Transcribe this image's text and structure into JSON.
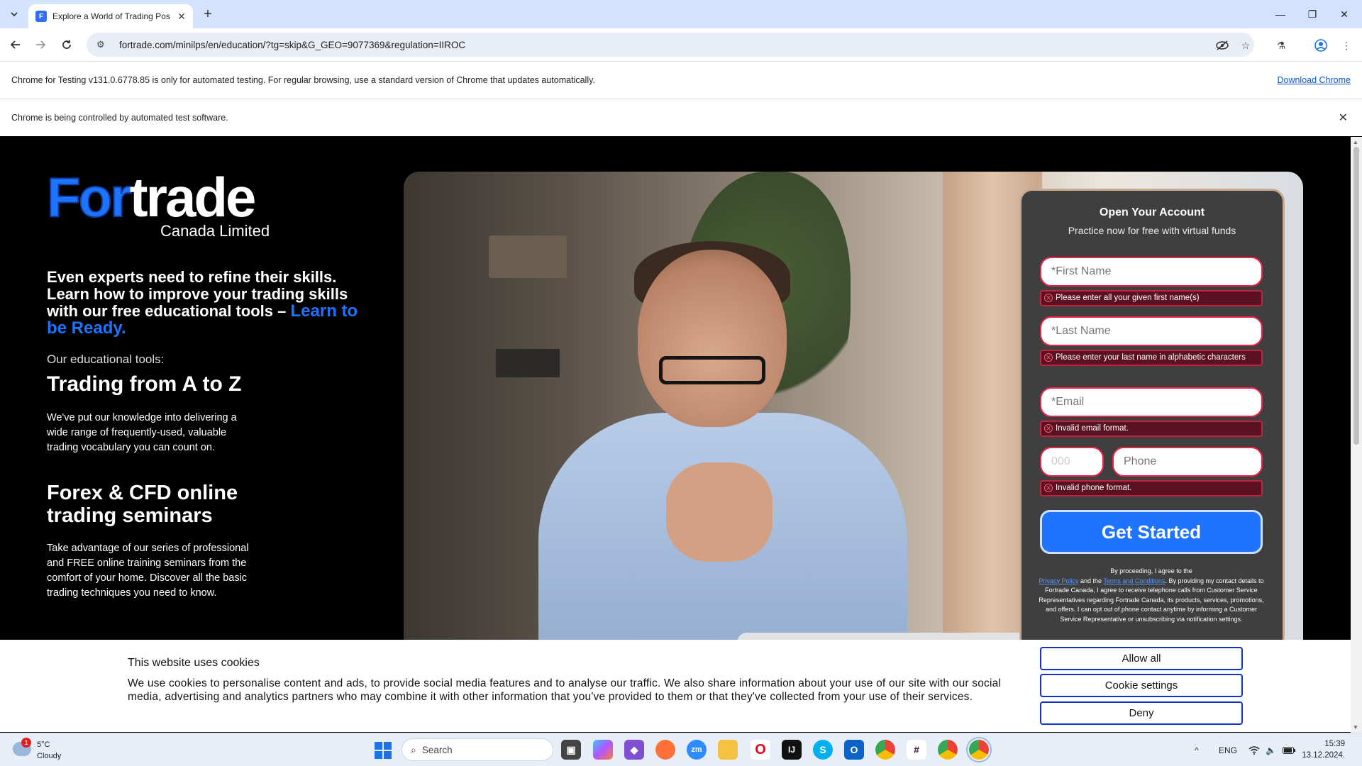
{
  "browser": {
    "tab_title": "Explore a World of Trading Pos",
    "tab_favicon_letter": "F",
    "new_tab_symbol": "+",
    "url": "fortrade.com/minilps/en/education/?tg=skip&G_GEO=9077369&regulation=IIROC",
    "infobar_testing": "Chrome for Testing v131.0.6778.85 is only for automated testing. For regular browsing, use a standard version of Chrome that updates automatically.",
    "infobar_download": "Download Chrome",
    "infobar_automation": "Chrome is being controlled by automated test software."
  },
  "page": {
    "logo": {
      "word_a": "For",
      "word_b": "trade",
      "subtitle": "Canada Limited"
    },
    "lead": "Even experts need to refine their skills. Learn how to improve your trading skills with our free educational tools –",
    "lead_highlight": "Learn to be Ready.",
    "tools_label": "Our educational tools:",
    "section1_title": "Trading from A to Z",
    "section1_text": "We've put our knowledge into delivering a wide range of frequently-used, valuable trading vocabulary you can count on.",
    "section2_title": "Forex & CFD online trading seminars",
    "section2_text": "Take advantage of our series of professional and FREE online training seminars from the comfort of your home. Discover all the basic trading techniques you need to know."
  },
  "form": {
    "title": "Open Your Account",
    "subtitle": "Practice now for free with virtual funds",
    "first_name_placeholder": "*First Name",
    "first_name_error": "Please enter all your given first name(s)",
    "last_name_placeholder": "*Last Name",
    "last_name_error": "Please enter your last name in alphabetic characters",
    "email_placeholder": "*Email",
    "email_error": "Invalid email format.",
    "country_code_placeholder": "000",
    "phone_placeholder": "Phone",
    "phone_error": "Invalid phone format.",
    "submit_label": "Get Started",
    "legal_1": "By proceeding, I agree to the",
    "legal_privacy": "Privacy Policy",
    "legal_and": "and the",
    "legal_terms": "Terms and Conditions",
    "legal_2": ". By providing my contact details to Fortrade Canada, I agree to receive telephone calls from Customer Service Representatives regarding Fortrade Canada, its products, services, promotions, and offers. I can opt out of phone contact anytime by informing a Customer Service Representative or unsubscribing via notification settings."
  },
  "cookie": {
    "title": "This website uses cookies",
    "text": "We use cookies to personalise content and ads, to provide social media features and to analyse our traffic. We also share information about your use of our site with our social media, advertising and analytics partners who may combine it with other information that you've provided to them or that they've collected from your use of their services.",
    "allow_all": "Allow all",
    "settings": "Cookie settings",
    "deny": "Deny"
  },
  "taskbar": {
    "weather_temp": "5°C",
    "weather_desc": "Cloudy",
    "weather_badge": "1",
    "search_label": "Search",
    "lang": "ENG",
    "time": "15:39",
    "date": "13.12.2024."
  },
  "colors": {
    "brand_blue": "#1e73ff",
    "error_bg": "#5a1222",
    "cookie_button_border": "#1032cf"
  }
}
